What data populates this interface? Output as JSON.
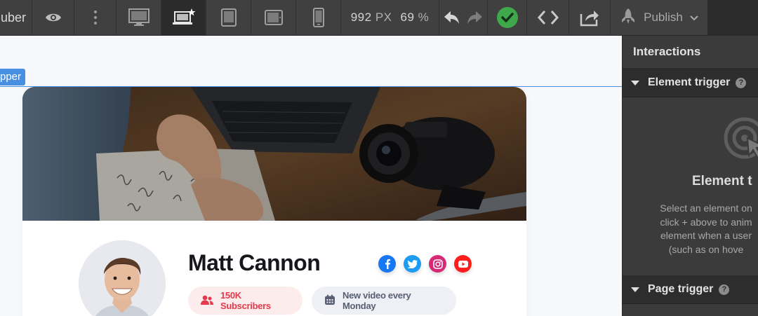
{
  "toolbar": {
    "site_name": "uber",
    "width_value": "992",
    "width_unit": "PX",
    "zoom_value": "69",
    "zoom_unit": "%",
    "publish_label": "Publish",
    "icons": [
      "eye-icon",
      "more-vertical-icon",
      "desktop-icon",
      "laptop-star-icon",
      "tablet-icon",
      "tablet-landscape-icon",
      "phone-icon",
      "undo-icon",
      "redo-icon",
      "check-circle-icon",
      "code-icon",
      "export-icon",
      "rocket-icon",
      "chevron-down-icon"
    ],
    "colors": {
      "bar": "#404040",
      "check": "#3fa84a"
    }
  },
  "canvas": {
    "selected_element_label": "pper",
    "selection_color": "#4a90e2"
  },
  "card": {
    "name": "Matt Cannon",
    "socials": [
      "facebook",
      "twitter",
      "instagram",
      "youtube"
    ],
    "subscribers": "150K Subscribers",
    "schedule": "New video every Monday",
    "colors": {
      "subs_text": "#e53a4b",
      "subs_bg": "#fdecec",
      "video_text": "#585e73",
      "video_bg": "#eef0f6"
    }
  },
  "panel": {
    "title": "Interactions",
    "element_trigger": {
      "label": "Element trigger",
      "empty_title": "Element t",
      "empty_lines": [
        "Select an element on",
        "click + above to anim",
        "element when a user",
        "(such as on hove"
      ]
    },
    "page_trigger": {
      "label": "Page trigger"
    }
  }
}
